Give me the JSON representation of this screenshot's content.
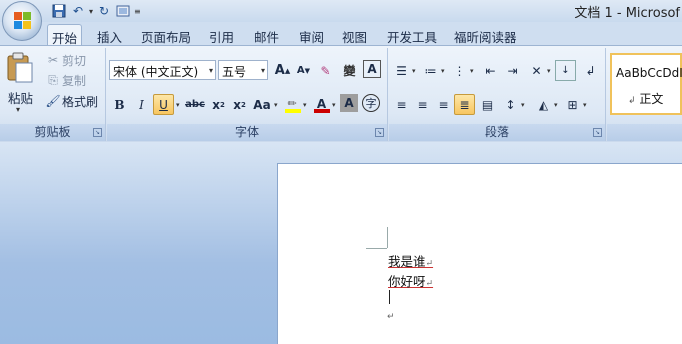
{
  "window": {
    "title": "文档 1 - Microsof"
  },
  "quick_access": {
    "icons": [
      "save-icon",
      "undo-icon",
      "redo-icon",
      "print-preview-icon"
    ]
  },
  "tabs": [
    {
      "label": "开始",
      "active": true
    },
    {
      "label": "插入"
    },
    {
      "label": "页面布局"
    },
    {
      "label": "引用"
    },
    {
      "label": "邮件"
    },
    {
      "label": "审阅"
    },
    {
      "label": "视图"
    },
    {
      "label": "开发工具"
    },
    {
      "label": "福昕阅读器"
    }
  ],
  "clipboard": {
    "paste": "粘贴",
    "cut": "剪切",
    "copy": "复制",
    "format_painter": "格式刷",
    "group_label": "剪贴板"
  },
  "font": {
    "font_name": "宋体 (中文正文)",
    "font_size": "五号",
    "grow": "A",
    "shrink": "A",
    "bold": "B",
    "italic": "I",
    "underline": "U",
    "strike": "abc",
    "subscript": "x",
    "superscript": "x",
    "change_case": "Aa",
    "font_color": "A",
    "char_shading": "A",
    "enclose": "字",
    "phonetic": "變",
    "border": "A",
    "group_label": "字体"
  },
  "paragraph": {
    "group_label": "段落"
  },
  "styles": {
    "sample": "AaBbCcDdI",
    "name": "正文"
  },
  "document": {
    "lines": [
      "我是谁",
      "你好呀"
    ]
  },
  "colors": {
    "accent_highlight": "#f8c660",
    "ribbon_blue": "#dde8f5",
    "highlight_yellow": "#ffff00",
    "font_red": "#cc0000"
  }
}
